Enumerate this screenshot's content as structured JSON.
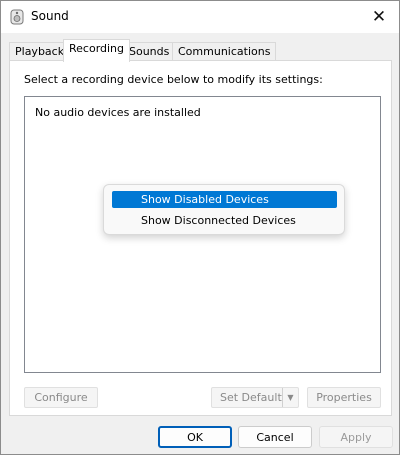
{
  "window": {
    "title": "Sound",
    "app_icon": "speaker-icon",
    "close_glyph": "✕"
  },
  "tabs": [
    {
      "label": "Playback"
    },
    {
      "label": "Recording"
    },
    {
      "label": "Sounds"
    },
    {
      "label": "Communications"
    }
  ],
  "active_tab": "Recording",
  "panel": {
    "instruction": "Select a recording device below to modify its settings:",
    "empty_message": "No audio devices are installed",
    "configure_label": "Configure",
    "set_default_label": "Set Default",
    "set_default_arrow": "▼",
    "properties_label": "Properties"
  },
  "context_menu": {
    "items": [
      {
        "label": "Show Disabled Devices",
        "highlighted": true
      },
      {
        "label": "Show Disconnected Devices",
        "highlighted": false
      }
    ]
  },
  "footer": {
    "ok_label": "OK",
    "cancel_label": "Cancel",
    "apply_label": "Apply"
  },
  "colors": {
    "accent": "#0078d4",
    "ok_border": "#005fb8",
    "disabled_text": "#8a8a8a"
  }
}
